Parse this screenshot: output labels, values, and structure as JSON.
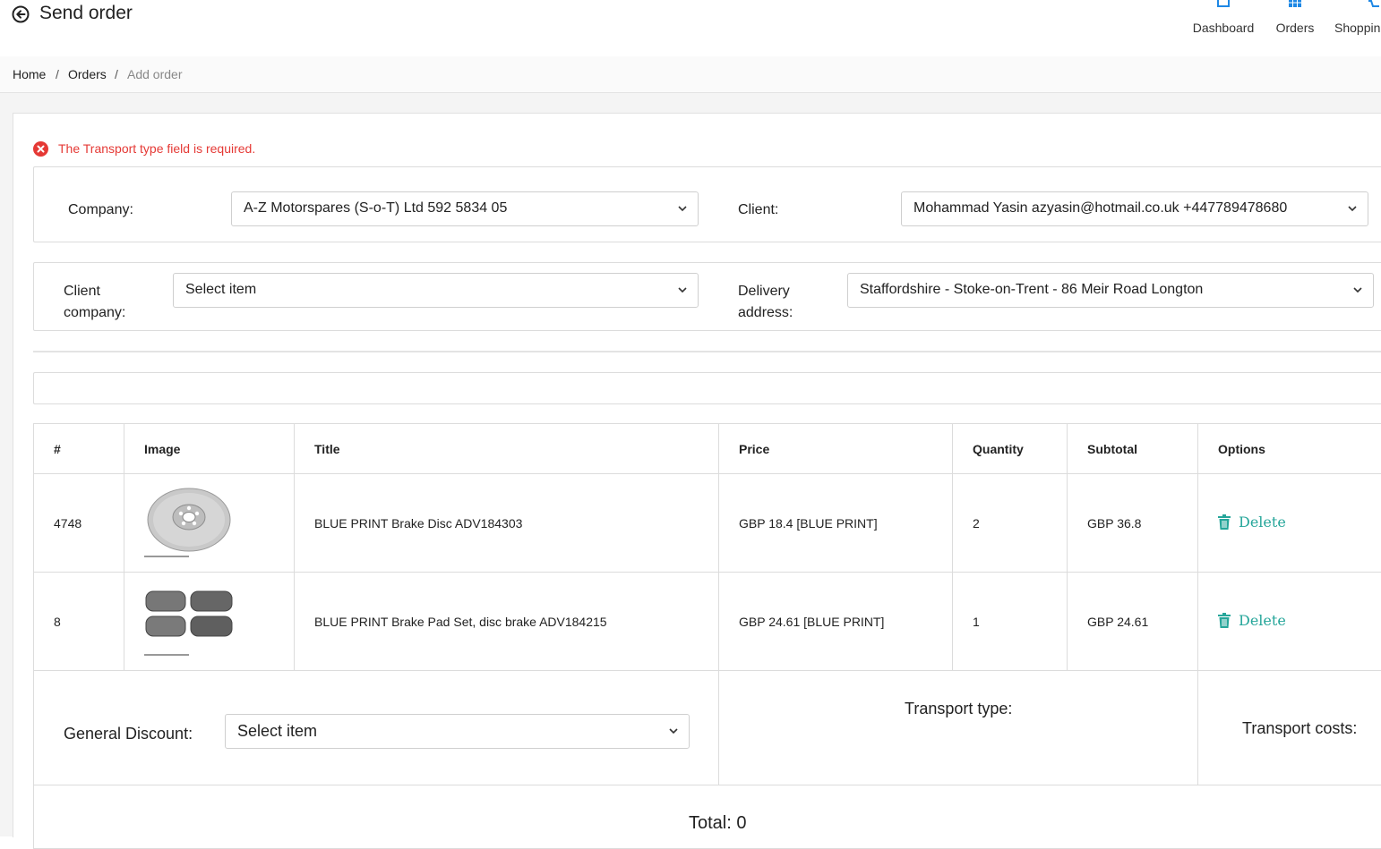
{
  "header": {
    "title": "Send order",
    "nav": [
      {
        "label": "Dashboard",
        "icon": "home-icon"
      },
      {
        "label": "Orders",
        "icon": "grid-icon"
      },
      {
        "label": "Shoppin",
        "icon": "cart-icon"
      }
    ]
  },
  "breadcrumb": [
    "Home",
    "Orders",
    "Add order"
  ],
  "error": "The Transport type field is required.",
  "form": {
    "company_label": "Company:",
    "company_value": "A-Z Motorspares (S-o-T) Ltd 592 5834 05",
    "client_label": "Client:",
    "client_value": "Mohammad Yasin azyasin@hotmail.co.uk +447789478680",
    "client_company_label_1": "Client",
    "client_company_label_2": "company:",
    "client_company_value": "Select item",
    "delivery_label_1": "Delivery",
    "delivery_label_2": "address:",
    "delivery_value": "Staffordshire - Stoke-on-Trent - 86 Meir Road Longton"
  },
  "table": {
    "headers": [
      "#",
      "Image",
      "Title",
      "Price",
      "Quantity",
      "Subtotal",
      "Options"
    ],
    "rows": [
      {
        "id": "4748",
        "image": "brake-disc",
        "title": "BLUE PRINT Brake Disc ADV184303",
        "price": "GBP 18.4 [BLUE PRINT]",
        "quantity": "2",
        "subtotal": "GBP 36.8",
        "option": "Delete"
      },
      {
        "id": "8",
        "image": "brake-pad-set",
        "title": "BLUE PRINT Brake Pad Set, disc brake ADV184215",
        "price": "GBP 24.61 [BLUE PRINT]",
        "quantity": "1",
        "subtotal": "GBP 24.61",
        "option": "Delete"
      }
    ]
  },
  "footer": {
    "discount_label": "General Discount:",
    "discount_value": "Select item",
    "transport_type_label": "Transport type:",
    "transport_costs_label": "Transport costs:",
    "total": "Total: 0"
  },
  "colors": {
    "accent": "#26a69a",
    "error": "#e53935",
    "nav_icon": "#1e88e5"
  }
}
